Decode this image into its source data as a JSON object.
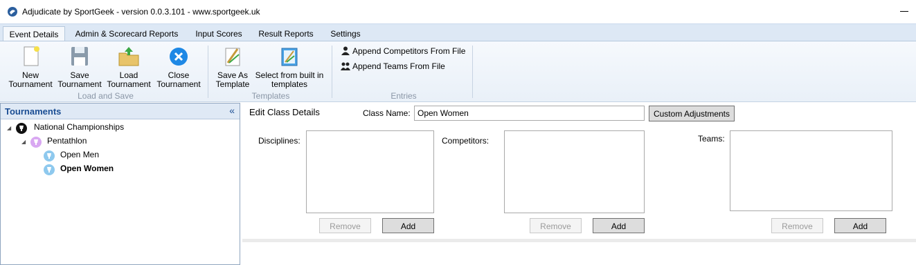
{
  "window": {
    "title": "Adjudicate by SportGeek -  version 0.0.3.101 - www.sportgeek.uk"
  },
  "ribbon_tabs": [
    {
      "label": "Event Details",
      "active": true
    },
    {
      "label": "Admin & Scorecard Reports",
      "active": false
    },
    {
      "label": "Input Scores",
      "active": false
    },
    {
      "label": "Result Reports",
      "active": false
    },
    {
      "label": "Settings",
      "active": false
    }
  ],
  "ribbon": {
    "load_and_save": {
      "group_label": "Load and Save",
      "new_tournament": {
        "line1": "New",
        "line2": "Tournament"
      },
      "save_tournament": {
        "line1": "Save",
        "line2": "Tournament"
      },
      "load_tournament": {
        "line1": "Load",
        "line2": "Tournament"
      },
      "close_tournament": {
        "line1": "Close",
        "line2": "Tournament"
      }
    },
    "templates": {
      "group_label": "Templates",
      "save_as_template": {
        "line1": "Save As",
        "line2": "Template"
      },
      "select_builtin": {
        "line1": "Select from built in",
        "line2": "templates"
      }
    },
    "entries": {
      "group_label": "Entries",
      "append_competitors": "Append Competitors From File",
      "append_teams": "Append Teams From File"
    }
  },
  "tournaments_panel": {
    "title": "Tournaments",
    "collapse_glyph": "«",
    "tree": {
      "championship": "National Championships",
      "event": "Pentathlon",
      "classes": [
        "Open Men",
        "Open Women"
      ]
    }
  },
  "edit_class": {
    "title": "Edit Class Details",
    "class_name_label": "Class Name:",
    "class_name_value": "Open Women",
    "custom_adjustments_label": "Custom Adjustments",
    "disciplines_label": "Disciplines:",
    "competitors_label": "Competitors:",
    "teams_label": "Teams:",
    "remove_label": "Remove",
    "add_label": "Add"
  },
  "colors": {
    "accent": "#1a4d93",
    "tab_bar": "#dde8f5",
    "close_icon": "#1e88e5",
    "trophy_dark": "#111111",
    "trophy_purple": "#d9a8f2",
    "trophy_blue": "#8ec9ee"
  }
}
